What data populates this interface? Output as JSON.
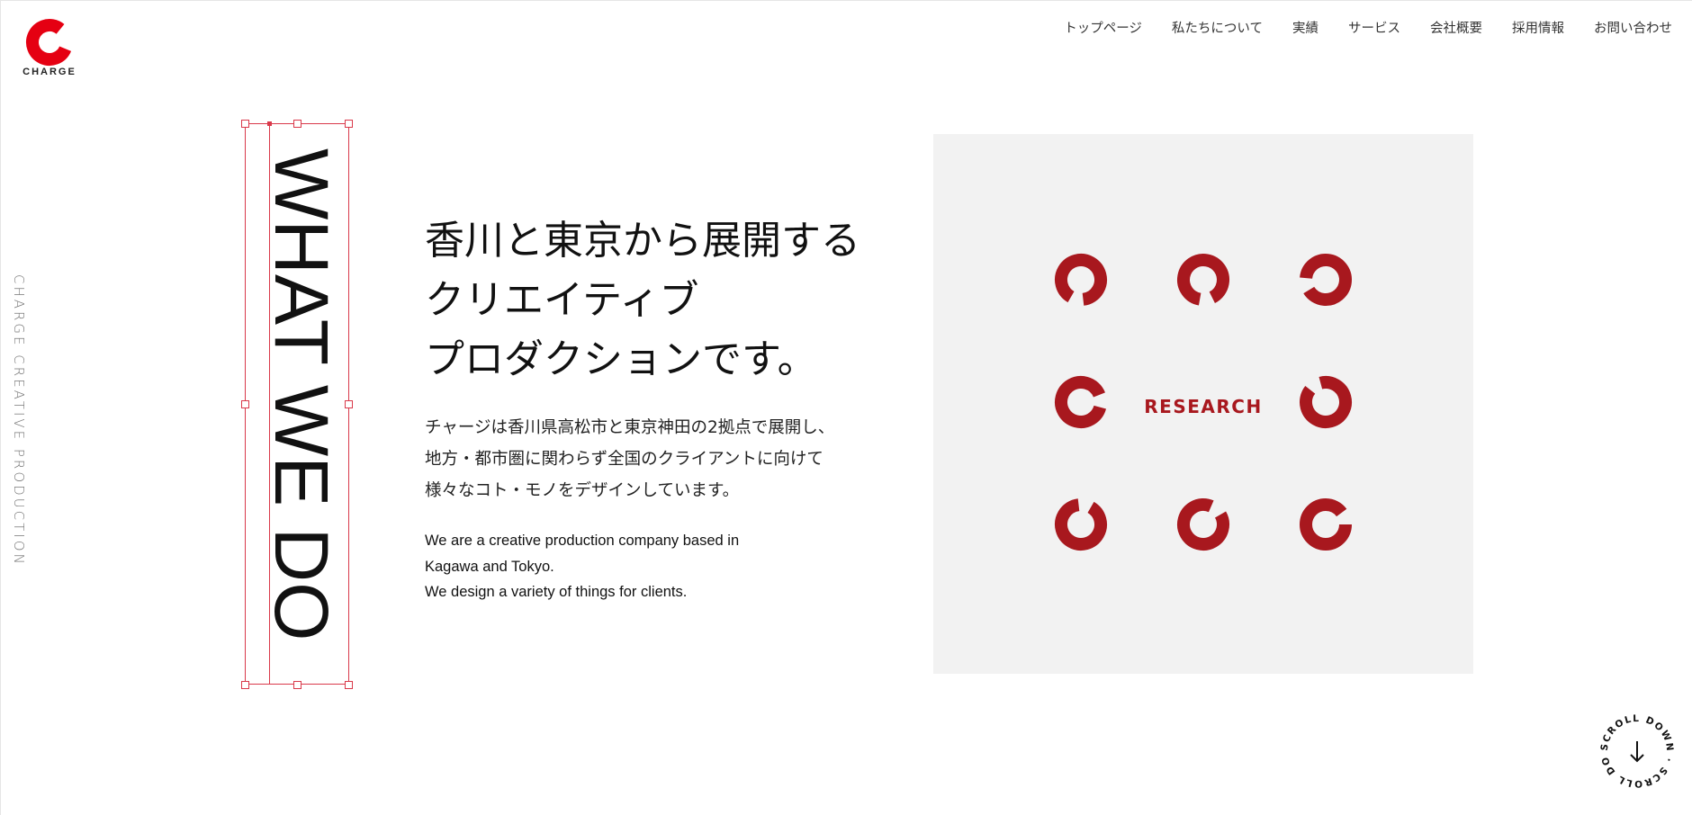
{
  "brand": {
    "logo_text": "CHARGE",
    "color": "#e50012"
  },
  "nav": [
    {
      "label": "トップページ"
    },
    {
      "label": "私たちについて"
    },
    {
      "label": "実績"
    },
    {
      "label": "サービス"
    },
    {
      "label": "会社概要"
    },
    {
      "label": "採用情報"
    },
    {
      "label": "お問い合わせ"
    }
  ],
  "side_text": "CHARGE CREATIVE PRODUCTION",
  "section_title": "WHAT WE DO",
  "heading_lines": [
    "香川と東京から展開する",
    "クリエイティブ",
    "プロダクションです。"
  ],
  "description_ja": [
    "チャージは香川県高松市と東京神田の2拠点で展開し、",
    "地方・都市圏に関わらず全国のクライアントに向けて",
    "様々なコト・モノをデザインしています。"
  ],
  "description_en": [
    "We are a creative production company based in",
    "Kagawa and Tokyo.",
    "We design a variety of things for clients."
  ],
  "panel": {
    "label": "RESEARCH",
    "accent": "#a8181e",
    "background": "#f2f2f2"
  },
  "scroll_badge": {
    "text": "SCROLL DOWN · SCROLL DOWN · ",
    "icon": "arrow-down-icon"
  },
  "selection_color": "#d9394a"
}
